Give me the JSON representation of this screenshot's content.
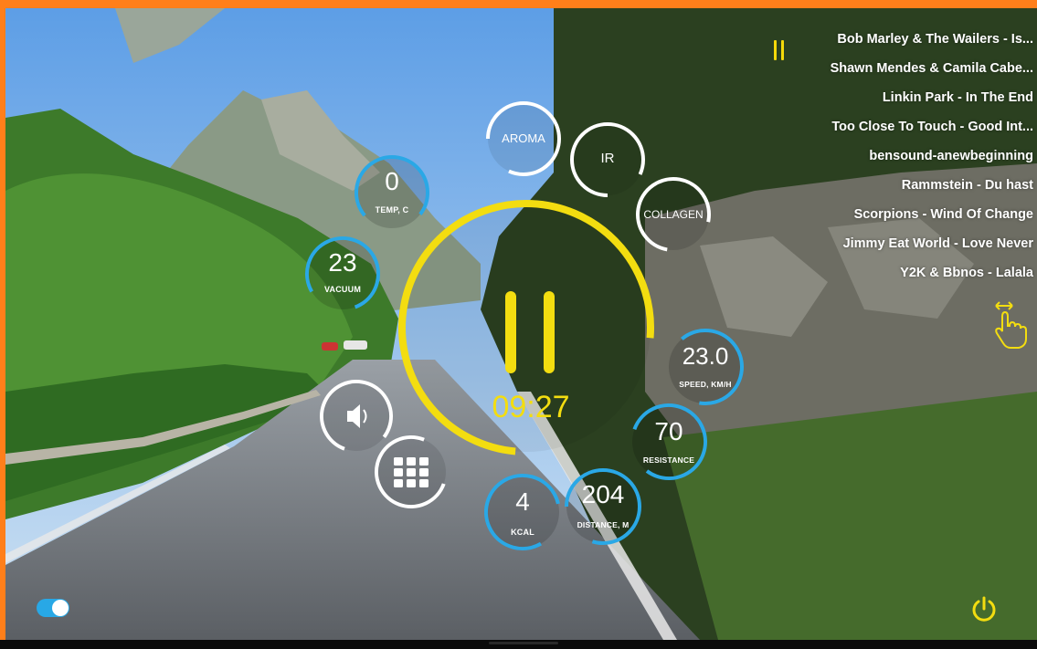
{
  "colors": {
    "accent": "#f3dd10",
    "metric_ring": "#2aa8e6",
    "frame": "#ff7f1a"
  },
  "gauges": {
    "temp": {
      "value": "0",
      "label": "TEMP, C"
    },
    "vacuum": {
      "value": "23",
      "label": "VACUUM"
    },
    "aroma": {
      "word": "AROMA"
    },
    "ir": {
      "word": "IR"
    },
    "collagen": {
      "word": "COLLAGEN"
    },
    "speed": {
      "value": "23.0",
      "label": "SPEED, KM/H"
    },
    "resistance": {
      "value": "70",
      "label": "RESISTANCE"
    },
    "kcal": {
      "value": "4",
      "label": "KCAL"
    },
    "distance": {
      "value": "204",
      "label": "DISTANCE, M"
    }
  },
  "timer": "09:27",
  "playlist": [
    "Bob Marley & The Wailers - Is...",
    "Shawn Mendes & Camila Cabe...",
    "Linkin Park - In The End",
    "Too Close To Touch - Good Int...",
    "bensound-anewbeginning",
    "Rammstein - Du hast",
    "Scorpions - Wind Of Change",
    "Jimmy Eat World - Love Never",
    "Y2K & Bbnos - Lalala"
  ],
  "icons": {
    "main_pause": "pause-icon",
    "playlist_pause": "pause-icon",
    "volume": "speaker-icon",
    "menu": "grid-icon",
    "swipe": "hand-swipe-icon",
    "power": "power-icon",
    "toggle": "toggle-switch"
  }
}
